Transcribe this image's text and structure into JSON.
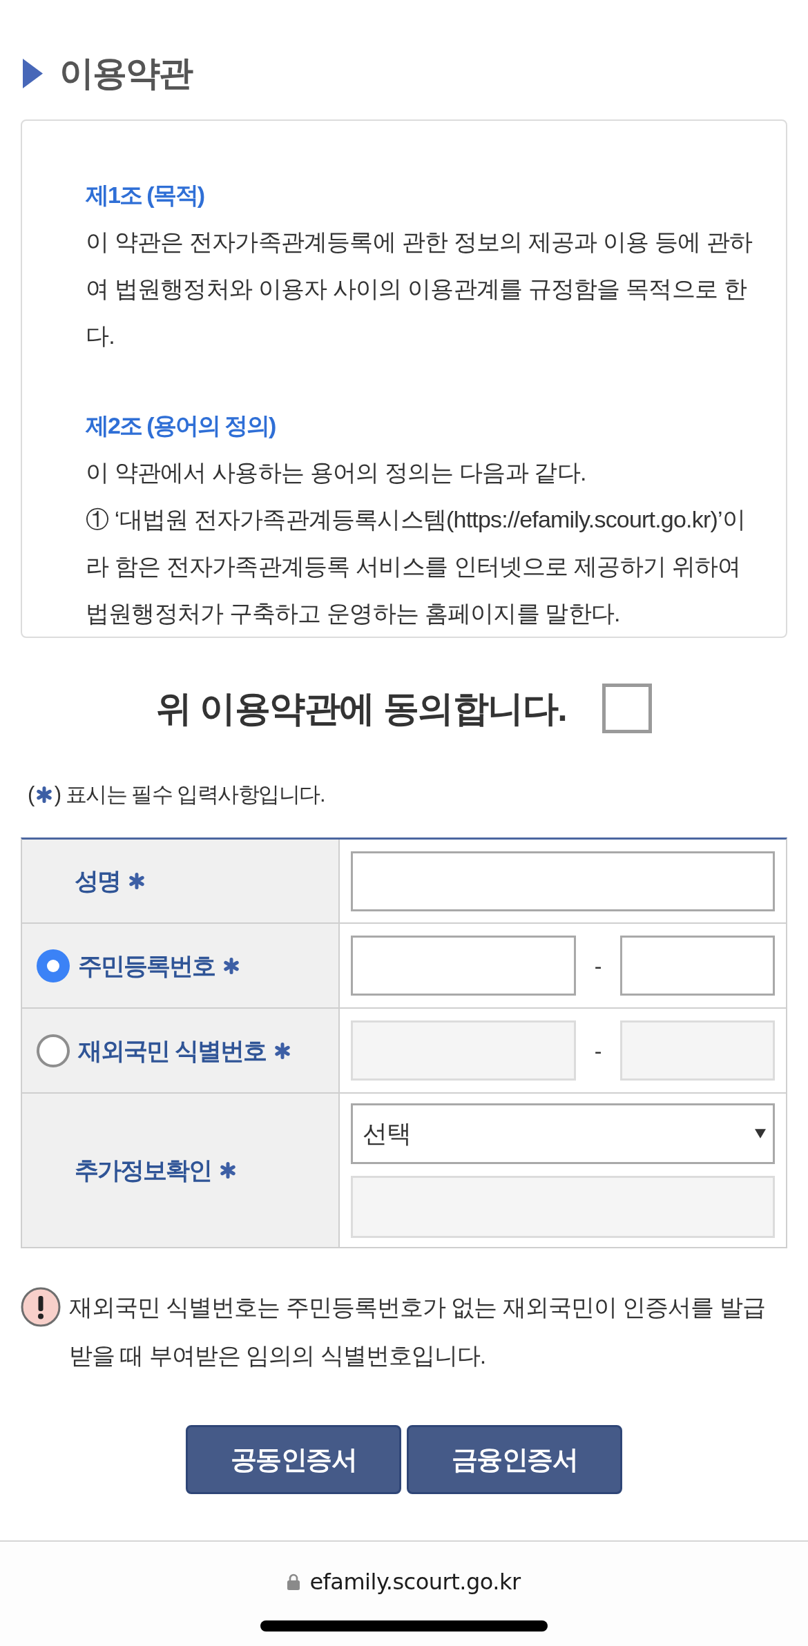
{
  "section": {
    "title": "이용약관"
  },
  "terms": {
    "articles": [
      {
        "heading": "제1조 (목적)",
        "paragraphs": [
          "이 약관은 전자가족관계등록에 관한 정보의 제공과 이용 등에 관하여 법원행정처와 이용자 사이의 이용관계를 규정함을 목적으로 한다."
        ]
      },
      {
        "heading": "제2조 (용어의 정의)",
        "paragraphs": [
          "이 약관에서 사용하는 용어의 정의는 다음과 같다.",
          "① ‘대법원 전자가족관계등록시스템(https://efamily.scourt.go.kr)’이라 함은 전자가족관계등록 서비스를 인터넷으로 제공하기 위하여 법원행정처가 구축하고 운영하는 홈페이지를 말한다."
        ]
      }
    ]
  },
  "agreement": {
    "label": "위 이용약관에 동의합니다.",
    "checked": false
  },
  "required_note": {
    "before": "(",
    "after": ") 표시는 필수 입력사항입니다."
  },
  "form": {
    "rows": [
      {
        "kind": "text",
        "label": "성명",
        "required": true
      },
      {
        "kind": "split",
        "label": "주민등록번호",
        "required": true,
        "radio": {
          "selected": true
        },
        "disabled": false,
        "separator": "-"
      },
      {
        "kind": "split",
        "label": "재외국민 식별번호",
        "required": true,
        "radio": {
          "selected": false
        },
        "disabled": true,
        "separator": "-"
      },
      {
        "kind": "select",
        "label": "추가정보확인",
        "required": true,
        "value": "선택",
        "extra_input": {
          "disabled": true
        }
      }
    ]
  },
  "notice": {
    "text": "재외국민 식별번호는 주민등록번호가 없는 재외국민이 인증서를 발급받을 때 부여받은 임의의 식별번호입니다."
  },
  "buttons": [
    {
      "label": "공동인증서"
    },
    {
      "label": "금융인증서"
    }
  ],
  "browser_bar": {
    "url": "efamily.scourt.go.kr"
  }
}
